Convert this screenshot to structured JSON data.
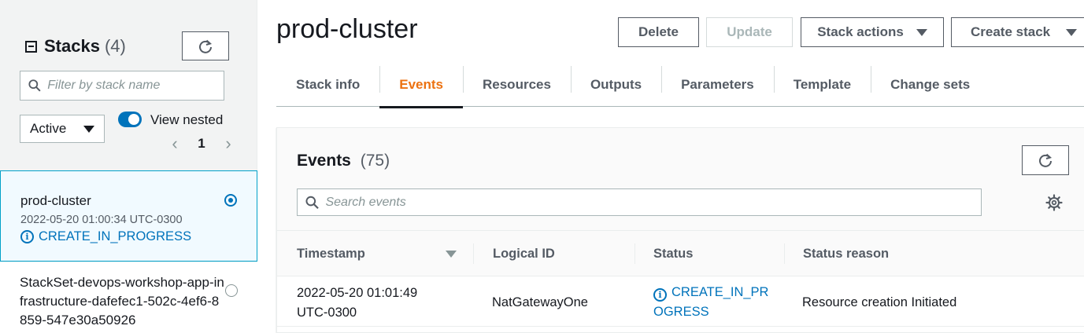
{
  "sidebar": {
    "title": "Stacks",
    "count": "(4)",
    "filter_placeholder": "Filter by stack name",
    "status_filter": "Active",
    "view_nested_label": "View nested",
    "page_number": "1",
    "stacks": [
      {
        "name": "prod-cluster",
        "date": "2022-05-20 01:00:34 UTC-0300",
        "status": "CREATE_IN_PROGRESS",
        "selected": true
      },
      {
        "name": "StackSet-devops-workshop-app-infrastructure-dafefec1-502c-4ef6-8859-547e30a50926",
        "selected": false
      }
    ]
  },
  "header": {
    "title": "prod-cluster",
    "buttons": {
      "delete": "Delete",
      "update": "Update",
      "stack_actions": "Stack actions",
      "create_stack": "Create stack"
    }
  },
  "tabs": [
    "Stack info",
    "Events",
    "Resources",
    "Outputs",
    "Parameters",
    "Template",
    "Change sets"
  ],
  "active_tab": "Events",
  "events": {
    "title": "Events",
    "count": "(75)",
    "search_placeholder": "Search events",
    "columns": [
      "Timestamp",
      "Logical ID",
      "Status",
      "Status reason"
    ],
    "rows": [
      {
        "timestamp_line1": "2022-05-20 01:01:49",
        "timestamp_line2": "UTC-0300",
        "logical_id": "NatGatewayOne",
        "status_line1": "CREATE_IN_PR",
        "status_line2": "OGRESS",
        "status_reason": "Resource creation Initiated"
      }
    ]
  },
  "colors": {
    "accent": "#ec7211",
    "link": "#0073bb",
    "selected_bg": "#f1faff",
    "selected_border": "#00a1c9"
  }
}
